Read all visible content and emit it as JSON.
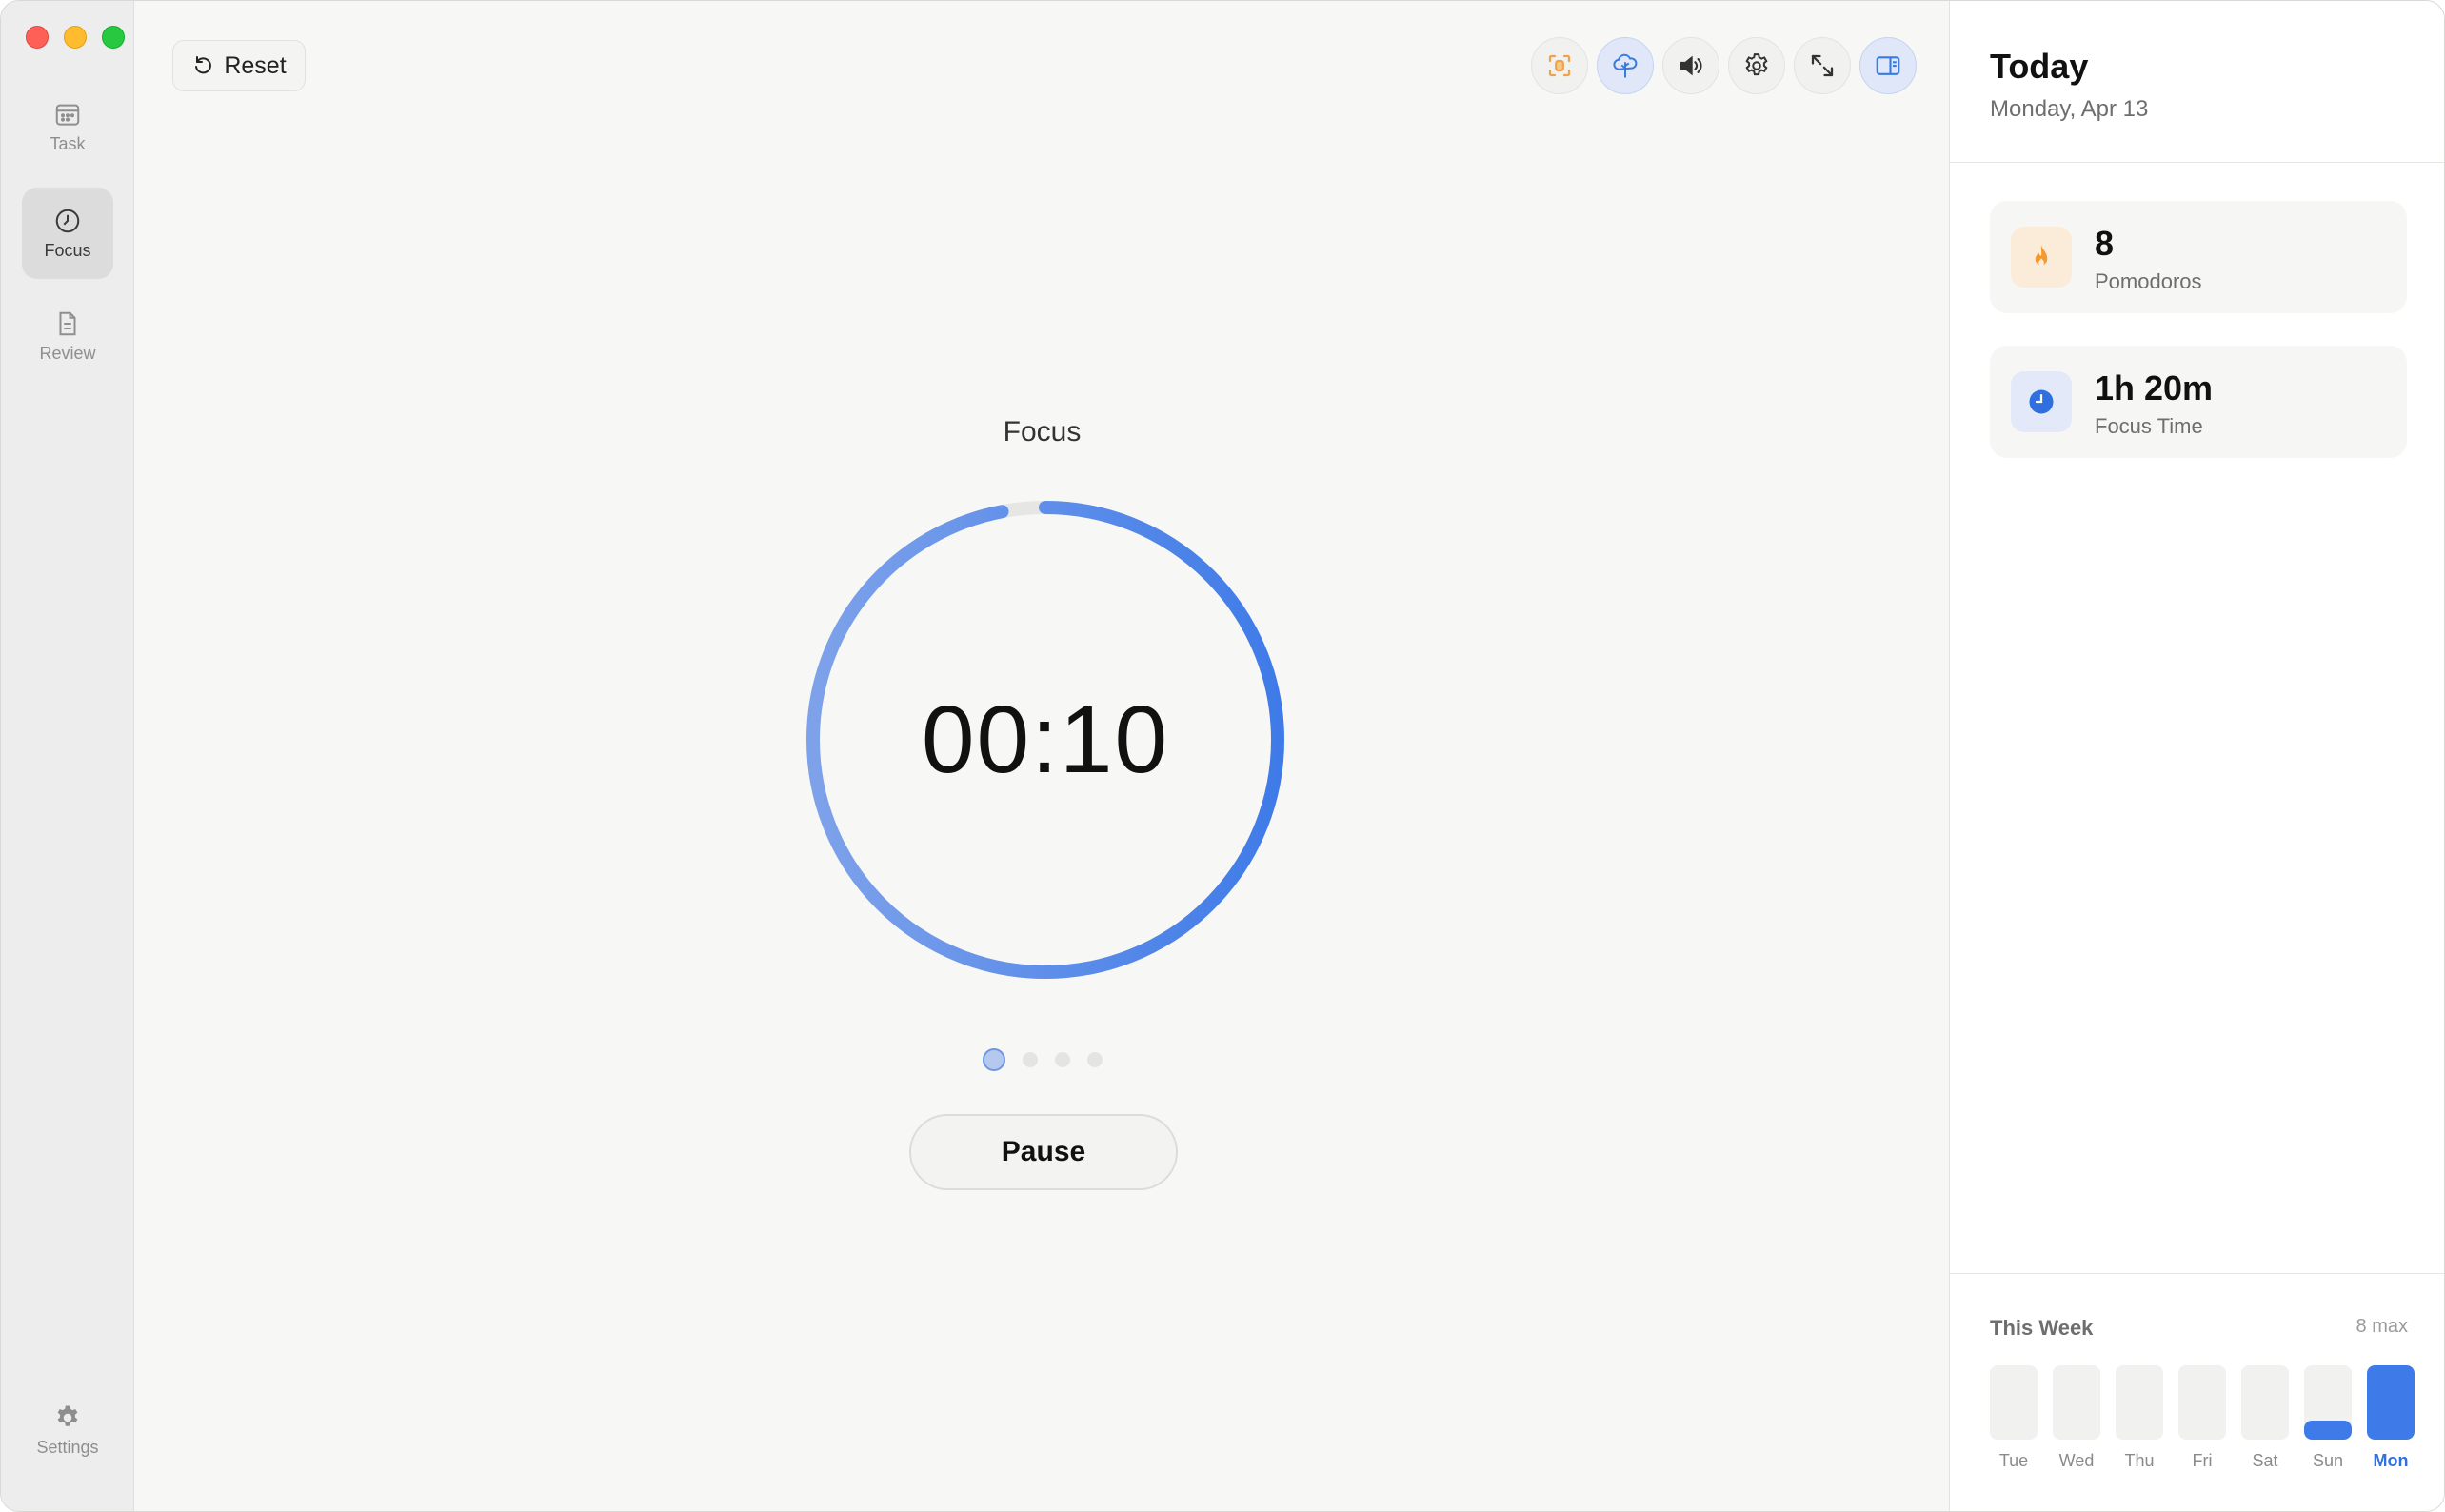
{
  "window": {
    "controls": [
      "close",
      "minimize",
      "maximize"
    ]
  },
  "sidebar": {
    "items": [
      {
        "label": "Task",
        "icon": "calendar-icon",
        "active": false
      },
      {
        "label": "Focus",
        "icon": "timer-icon",
        "active": true
      },
      {
        "label": "Review",
        "icon": "document-icon",
        "active": false
      }
    ],
    "settings_label": "Settings"
  },
  "toolbar": {
    "reset_label": "Reset",
    "buttons": [
      {
        "name": "focus-mode-button",
        "icon": "scan-focus-icon",
        "color": "#f0a24a"
      },
      {
        "name": "tree-button",
        "icon": "tree-icon",
        "color": "#3a7be0",
        "active": true
      },
      {
        "name": "sound-button",
        "icon": "speaker-icon",
        "color": "#333333"
      },
      {
        "name": "settings-button",
        "icon": "gear-icon",
        "color": "#333333"
      },
      {
        "name": "fullscreen-button",
        "icon": "expand-icon",
        "color": "#333333"
      },
      {
        "name": "sidebar-toggle-button",
        "icon": "sidebar-icon",
        "color": "#3a7be0",
        "active": true
      }
    ]
  },
  "timer": {
    "mode": "Focus",
    "time": "00:10",
    "progress": 0.97,
    "session_index": 1,
    "session_count": 4,
    "pause_label": "Pause"
  },
  "colors": {
    "accent": "#3f7be8",
    "accent_light": "#7ea2ea",
    "pomodoro_orange": "#f39a2f"
  },
  "today": {
    "title": "Today",
    "date": "Monday, Apr 13",
    "stats": [
      {
        "value": "8",
        "label": "Pomodoros",
        "icon": "flame-icon"
      },
      {
        "value": "1h 20m",
        "label": "Focus Time",
        "icon": "clock-icon"
      }
    ]
  },
  "week": {
    "title": "This Week",
    "max_label": "8 max",
    "max": 8,
    "days": [
      {
        "label": "Tue",
        "value": 0
      },
      {
        "label": "Wed",
        "value": 0
      },
      {
        "label": "Thu",
        "value": 0
      },
      {
        "label": "Fri",
        "value": 0
      },
      {
        "label": "Sat",
        "value": 0
      },
      {
        "label": "Sun",
        "value": 2
      },
      {
        "label": "Mon",
        "value": 8,
        "today": true
      }
    ]
  }
}
